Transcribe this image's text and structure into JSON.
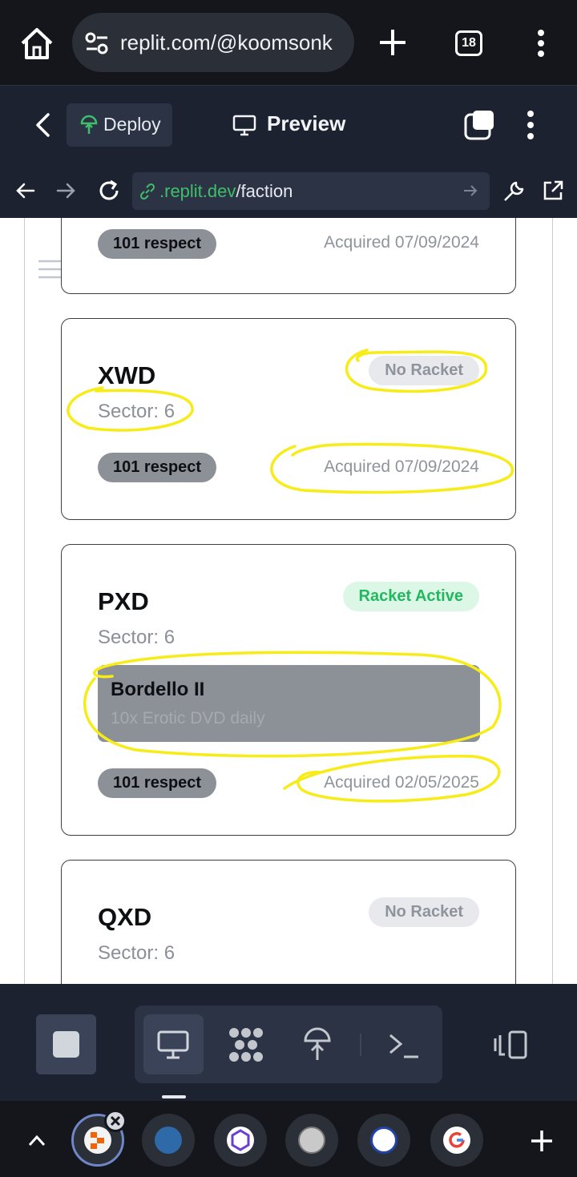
{
  "browser": {
    "url": "replit.com/@koomsonk",
    "tab_count": "18"
  },
  "replit_header": {
    "deploy_label": "Deploy",
    "preview_label": "Preview"
  },
  "address_bar": {
    "domain": ".replit.dev",
    "path": "/faction"
  },
  "cards": [
    {
      "respect": "101 respect",
      "acquired": "Acquired 07/09/2024"
    },
    {
      "name": "XWD",
      "sector": "Sector: 6",
      "status": "No Racket",
      "respect": "101 respect",
      "acquired": "Acquired 07/09/2024"
    },
    {
      "name": "PXD",
      "sector": "Sector: 6",
      "status": "Racket Active",
      "racket_title": "Bordello II",
      "racket_desc": "10x Erotic DVD daily",
      "respect": "101 respect",
      "acquired": "Acquired 02/05/2025"
    },
    {
      "name": "QXD",
      "sector": "Sector: 6",
      "status": "No Racket"
    }
  ],
  "colors": {
    "racket_active": "#22b860",
    "annotation": "#f7ec18",
    "link_domain": "#3fbf6a"
  },
  "toolbar": {
    "icons": [
      "stop-icon",
      "preview-icon",
      "workflows-icon",
      "deploy-icon",
      "shell-icon",
      "devices-icon"
    ]
  },
  "dock": {
    "apps": [
      "replit-app",
      "torn-stats-app",
      "polygon-app",
      "torn-app",
      "yata-tools-app",
      "google-app"
    ]
  }
}
